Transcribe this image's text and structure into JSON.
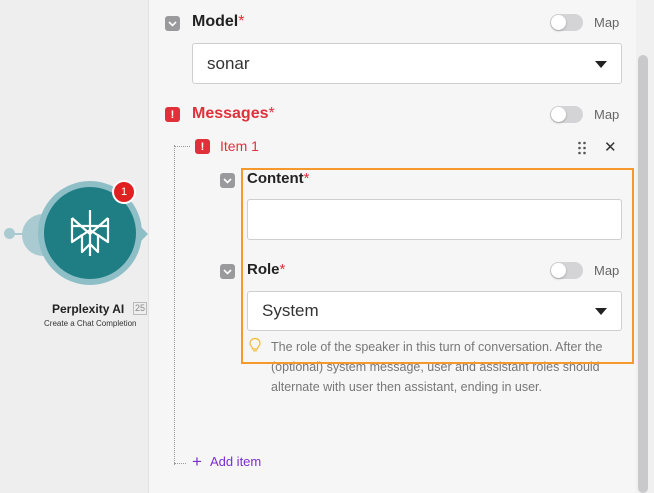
{
  "node": {
    "badge": "1",
    "title": "Perplexity AI",
    "id": "25",
    "subtitle": "Create a Chat Completion",
    "color": "#1f7d84"
  },
  "model": {
    "label": "Model",
    "required_mark": "*",
    "map_label": "Map",
    "value": "sonar"
  },
  "messages": {
    "label": "Messages",
    "required_mark": "*",
    "map_label": "Map",
    "item_label": "Item 1",
    "add_item_label": "Add item"
  },
  "content": {
    "label": "Content",
    "required_mark": "*",
    "value": ""
  },
  "role": {
    "label": "Role",
    "required_mark": "*",
    "map_label": "Map",
    "value": "System",
    "hint": "The role of the speaker in this turn of conversation. After the (optional) system message, user and assistant roles should alternate with user then assistant, ending in user."
  },
  "colors": {
    "error": "#e0303a",
    "highlight": "#f5992a",
    "accent": "#7b2fd0"
  },
  "icons": [
    "perplexity-logo-icon",
    "chevron-down-icon",
    "error-icon",
    "drag-handle-icon",
    "close-icon",
    "lightbulb-icon",
    "plus-icon",
    "caret-down-icon"
  ]
}
